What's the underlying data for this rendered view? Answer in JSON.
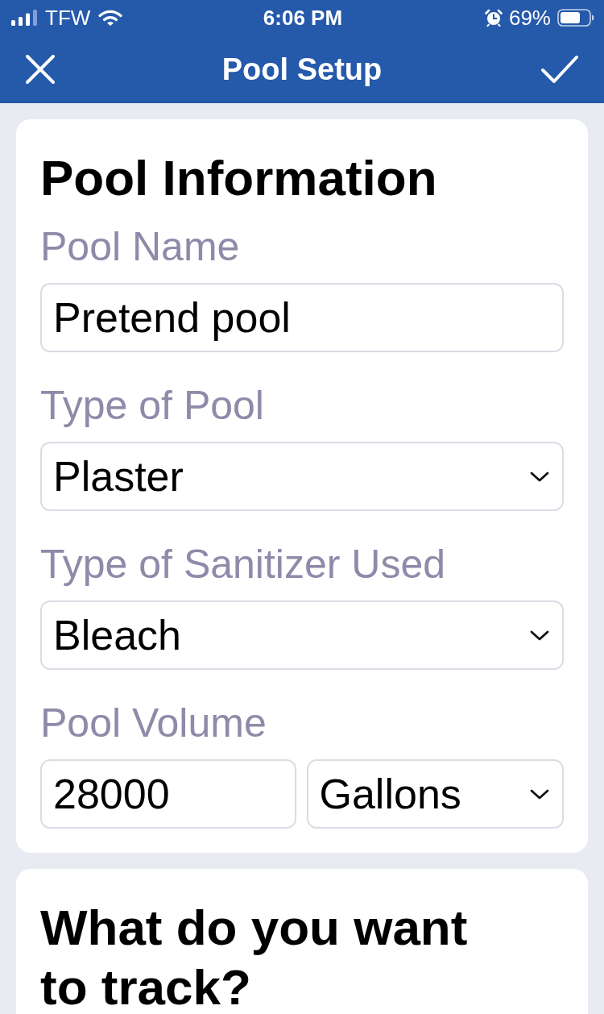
{
  "status_bar": {
    "carrier": "TFW",
    "time": "6:06 PM",
    "battery": "69%"
  },
  "header": {
    "title": "Pool Setup"
  },
  "sections": [
    {
      "title": "Pool Information",
      "fields": [
        {
          "label": "Pool Name",
          "inputs": [
            {
              "kind": "text",
              "value": "Pretend pool"
            }
          ]
        },
        {
          "label": "Type of Pool",
          "inputs": [
            {
              "kind": "select",
              "value": "Plaster"
            }
          ]
        },
        {
          "label": "Type of Sanitizer Used",
          "inputs": [
            {
              "kind": "select",
              "value": "Bleach"
            }
          ]
        },
        {
          "label": "Pool Volume",
          "inputs": [
            {
              "kind": "text",
              "value": "28000"
            },
            {
              "kind": "select",
              "value": "Gallons"
            }
          ]
        }
      ]
    },
    {
      "title": "What do you want to track?"
    }
  ]
}
